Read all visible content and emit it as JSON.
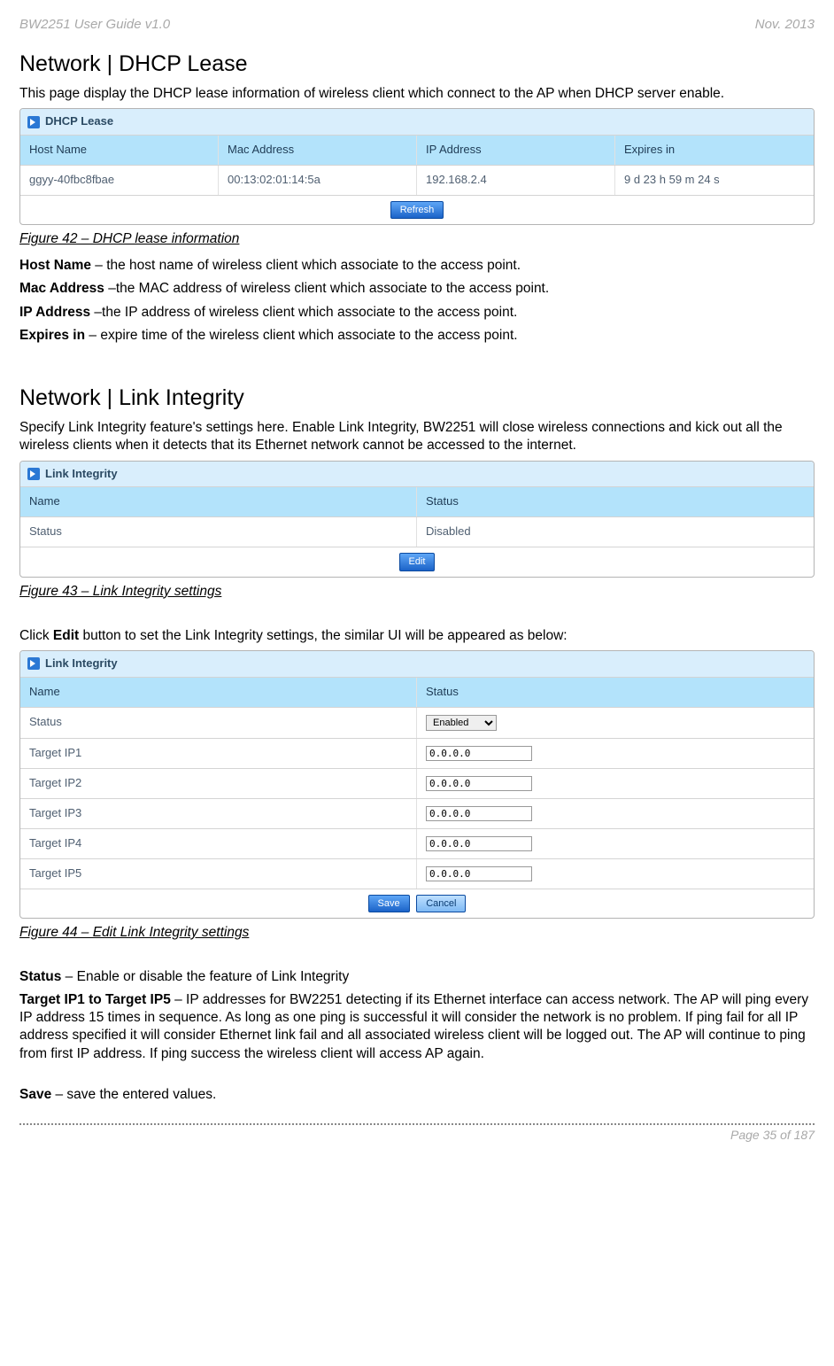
{
  "header": {
    "left": "BW2251 User Guide v1.0",
    "right": "Nov.  2013"
  },
  "section1": {
    "title": "Network | DHCP Lease",
    "intro": "This page display the DHCP lease information of wireless client which connect to the AP when DHCP server enable.",
    "panel_title": "DHCP Lease",
    "columns": [
      "Host Name",
      "Mac Address",
      "IP Address",
      "Expires in"
    ],
    "row": [
      "ggyy-40fbc8fbae",
      "00:13:02:01:14:5a",
      "192.168.2.4",
      "9 d 23 h 59 m 24 s"
    ],
    "refresh": "Refresh",
    "caption": "Figure 42 – DHCP lease information",
    "defs": [
      {
        "bold": "Host Name",
        "rest": " – the host name of wireless client which associate to the access point."
      },
      {
        "bold": "Mac Address",
        "rest": " –the MAC address of wireless client which associate to the access point."
      },
      {
        "bold": "IP Address",
        "rest": " –the IP address of wireless client which associate to the access point."
      },
      {
        "bold": "Expires in",
        "rest": " – expire time of the wireless client which associate to the access point."
      }
    ]
  },
  "section2": {
    "title": "Network | Link Integrity",
    "intro": "Specify Link Integrity feature's settings here. Enable Link Integrity, BW2251 will close wireless connections and kick out all the wireless clients when it detects that its Ethernet network cannot be accessed to the internet.",
    "panel_title": "Link Integrity",
    "head": [
      "Name",
      "Status"
    ],
    "row": [
      "Status",
      "Disabled"
    ],
    "edit": "Edit",
    "caption": "Figure 43 – Link Integrity settings",
    "click_text_pre": "Click ",
    "click_text_bold": "Edit",
    "click_text_post": " button to set the Link Integrity settings, the similar UI will be appeared as below:"
  },
  "section3": {
    "panel_title": "Link Integrity",
    "head": [
      "Name",
      "Status"
    ],
    "status_label": "Status",
    "status_value": "Enabled",
    "targets": [
      {
        "label": "Target IP1",
        "value": "0.0.0.0"
      },
      {
        "label": "Target IP2",
        "value": "0.0.0.0"
      },
      {
        "label": "Target IP3",
        "value": "0.0.0.0"
      },
      {
        "label": "Target IP4",
        "value": "0.0.0.0"
      },
      {
        "label": "Target IP5",
        "value": "0.0.0.0"
      }
    ],
    "save": "Save",
    "cancel": "Cancel",
    "caption": "Figure 44 – Edit  Link Integrity settings"
  },
  "defs2": [
    {
      "bold": "Status",
      "rest": " – Enable or disable the feature of Link Integrity"
    },
    {
      "bold": "Target IP1 to Target IP5",
      "rest": " – IP addresses for BW2251 detecting if its Ethernet interface can access network. The AP will ping every IP address 15 times in sequence. As long as one ping is successful it will consider the network is no problem. If ping fail for all IP address specified  it will consider Ethernet link fail and all associated wireless client will be logged out. The AP will continue to ping from first IP address. If ping success the wireless client will access AP again."
    }
  ],
  "save_def": {
    "bold": "Save",
    "rest": " – save the entered values."
  },
  "footer": "Page 35 of 187"
}
